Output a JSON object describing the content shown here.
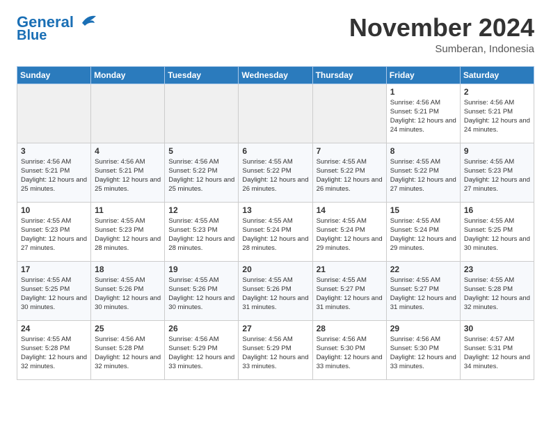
{
  "header": {
    "logo_line1": "General",
    "logo_line2": "Blue",
    "month": "November 2024",
    "location": "Sumberan, Indonesia"
  },
  "weekdays": [
    "Sunday",
    "Monday",
    "Tuesday",
    "Wednesday",
    "Thursday",
    "Friday",
    "Saturday"
  ],
  "weeks": [
    [
      {
        "day": "",
        "info": ""
      },
      {
        "day": "",
        "info": ""
      },
      {
        "day": "",
        "info": ""
      },
      {
        "day": "",
        "info": ""
      },
      {
        "day": "",
        "info": ""
      },
      {
        "day": "1",
        "info": "Sunrise: 4:56 AM\nSunset: 5:21 PM\nDaylight: 12 hours and 24 minutes."
      },
      {
        "day": "2",
        "info": "Sunrise: 4:56 AM\nSunset: 5:21 PM\nDaylight: 12 hours and 24 minutes."
      }
    ],
    [
      {
        "day": "3",
        "info": "Sunrise: 4:56 AM\nSunset: 5:21 PM\nDaylight: 12 hours and 25 minutes."
      },
      {
        "day": "4",
        "info": "Sunrise: 4:56 AM\nSunset: 5:21 PM\nDaylight: 12 hours and 25 minutes."
      },
      {
        "day": "5",
        "info": "Sunrise: 4:56 AM\nSunset: 5:22 PM\nDaylight: 12 hours and 25 minutes."
      },
      {
        "day": "6",
        "info": "Sunrise: 4:55 AM\nSunset: 5:22 PM\nDaylight: 12 hours and 26 minutes."
      },
      {
        "day": "7",
        "info": "Sunrise: 4:55 AM\nSunset: 5:22 PM\nDaylight: 12 hours and 26 minutes."
      },
      {
        "day": "8",
        "info": "Sunrise: 4:55 AM\nSunset: 5:22 PM\nDaylight: 12 hours and 27 minutes."
      },
      {
        "day": "9",
        "info": "Sunrise: 4:55 AM\nSunset: 5:23 PM\nDaylight: 12 hours and 27 minutes."
      }
    ],
    [
      {
        "day": "10",
        "info": "Sunrise: 4:55 AM\nSunset: 5:23 PM\nDaylight: 12 hours and 27 minutes."
      },
      {
        "day": "11",
        "info": "Sunrise: 4:55 AM\nSunset: 5:23 PM\nDaylight: 12 hours and 28 minutes."
      },
      {
        "day": "12",
        "info": "Sunrise: 4:55 AM\nSunset: 5:23 PM\nDaylight: 12 hours and 28 minutes."
      },
      {
        "day": "13",
        "info": "Sunrise: 4:55 AM\nSunset: 5:24 PM\nDaylight: 12 hours and 28 minutes."
      },
      {
        "day": "14",
        "info": "Sunrise: 4:55 AM\nSunset: 5:24 PM\nDaylight: 12 hours and 29 minutes."
      },
      {
        "day": "15",
        "info": "Sunrise: 4:55 AM\nSunset: 5:24 PM\nDaylight: 12 hours and 29 minutes."
      },
      {
        "day": "16",
        "info": "Sunrise: 4:55 AM\nSunset: 5:25 PM\nDaylight: 12 hours and 30 minutes."
      }
    ],
    [
      {
        "day": "17",
        "info": "Sunrise: 4:55 AM\nSunset: 5:25 PM\nDaylight: 12 hours and 30 minutes."
      },
      {
        "day": "18",
        "info": "Sunrise: 4:55 AM\nSunset: 5:26 PM\nDaylight: 12 hours and 30 minutes."
      },
      {
        "day": "19",
        "info": "Sunrise: 4:55 AM\nSunset: 5:26 PM\nDaylight: 12 hours and 30 minutes."
      },
      {
        "day": "20",
        "info": "Sunrise: 4:55 AM\nSunset: 5:26 PM\nDaylight: 12 hours and 31 minutes."
      },
      {
        "day": "21",
        "info": "Sunrise: 4:55 AM\nSunset: 5:27 PM\nDaylight: 12 hours and 31 minutes."
      },
      {
        "day": "22",
        "info": "Sunrise: 4:55 AM\nSunset: 5:27 PM\nDaylight: 12 hours and 31 minutes."
      },
      {
        "day": "23",
        "info": "Sunrise: 4:55 AM\nSunset: 5:28 PM\nDaylight: 12 hours and 32 minutes."
      }
    ],
    [
      {
        "day": "24",
        "info": "Sunrise: 4:55 AM\nSunset: 5:28 PM\nDaylight: 12 hours and 32 minutes."
      },
      {
        "day": "25",
        "info": "Sunrise: 4:56 AM\nSunset: 5:28 PM\nDaylight: 12 hours and 32 minutes."
      },
      {
        "day": "26",
        "info": "Sunrise: 4:56 AM\nSunset: 5:29 PM\nDaylight: 12 hours and 33 minutes."
      },
      {
        "day": "27",
        "info": "Sunrise: 4:56 AM\nSunset: 5:29 PM\nDaylight: 12 hours and 33 minutes."
      },
      {
        "day": "28",
        "info": "Sunrise: 4:56 AM\nSunset: 5:30 PM\nDaylight: 12 hours and 33 minutes."
      },
      {
        "day": "29",
        "info": "Sunrise: 4:56 AM\nSunset: 5:30 PM\nDaylight: 12 hours and 33 minutes."
      },
      {
        "day": "30",
        "info": "Sunrise: 4:57 AM\nSunset: 5:31 PM\nDaylight: 12 hours and 34 minutes."
      }
    ]
  ]
}
